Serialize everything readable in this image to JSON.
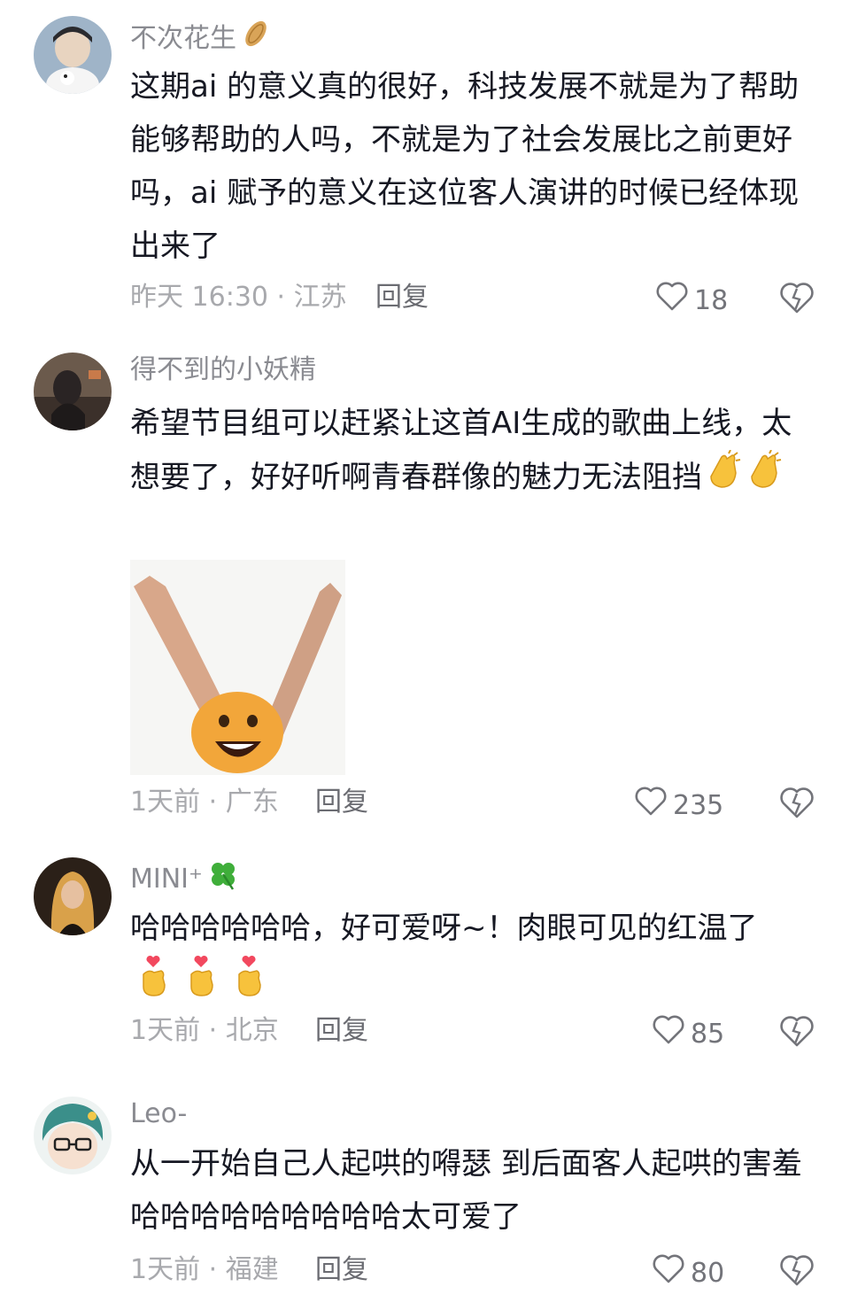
{
  "comments": [
    {
      "username": "不次花生",
      "username_icon": "peanut-icon",
      "text": "这期ai 的意义真的很好，科技发展不就是为了帮助能够帮助的人吗，不就是为了社会发展比之前更好吗，ai 赋予的意义在这位客人演讲的时候已经体现出来了",
      "time_location": "昨天 16:30 · 江苏",
      "reply_label": "回复",
      "likes": "18"
    },
    {
      "username": "得不到的小妖精",
      "text": "希望节目组可以赶紧让这首AI生成的歌曲上线，太想要了，好好听啊青春群像的魅力无法阻挡",
      "text_emojis": [
        "clapping-hands-icon",
        "clapping-hands-icon"
      ],
      "has_sticker": true,
      "time_location": "1天前 · 广东",
      "reply_label": "回复",
      "likes": "235"
    },
    {
      "username": "MINI⁺",
      "username_icon": "four-leaf-clover-icon",
      "text": "哈哈哈哈哈哈，好可爱呀~！肉眼可见的红温了",
      "text_emojis": [
        "finger-heart-icon",
        "finger-heart-icon",
        "finger-heart-icon"
      ],
      "time_location": "1天前 · 北京",
      "reply_label": "回复",
      "likes": "85"
    },
    {
      "username": "Leo-",
      "text": "从一开始自己人起哄的嘚瑟 到后面客人起哄的害羞哈哈哈哈哈哈哈哈哈太可爱了",
      "time_location": "1天前 · 福建",
      "reply_label": "回复",
      "likes": "80"
    }
  ],
  "colors": {
    "text": "#161823",
    "secondary": "#a8a9ad",
    "username": "#8a8b91"
  }
}
